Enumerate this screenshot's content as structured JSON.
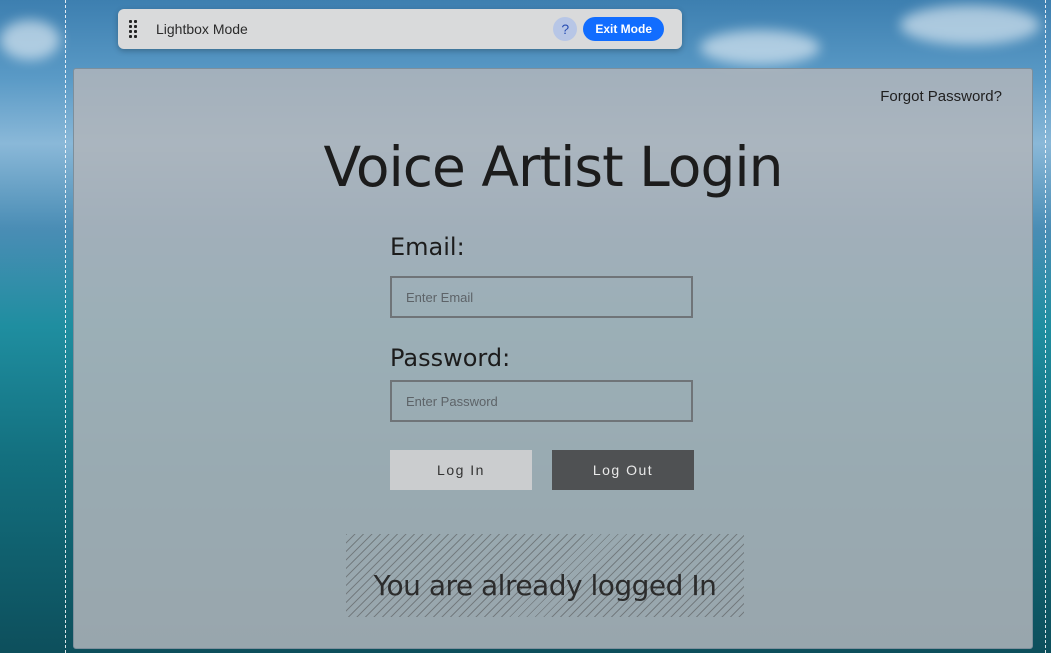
{
  "toolbar": {
    "drag_icon": "drag-handle-icon",
    "title": "Lightbox Mode",
    "help_label": "?",
    "exit_label": "Exit Mode"
  },
  "lightbox": {
    "forgot_password": "Forgot Password?",
    "title": "Voice Artist Login",
    "email_label": "Email:",
    "email_placeholder": "Enter Email",
    "password_label": "Password:",
    "password_placeholder": "Enter Password",
    "login_label": "Log In",
    "logout_label": "Log Out",
    "status": "You are already logged In"
  },
  "colors": {
    "exit_button": "#116dff",
    "logout_button": "#4f5153"
  }
}
